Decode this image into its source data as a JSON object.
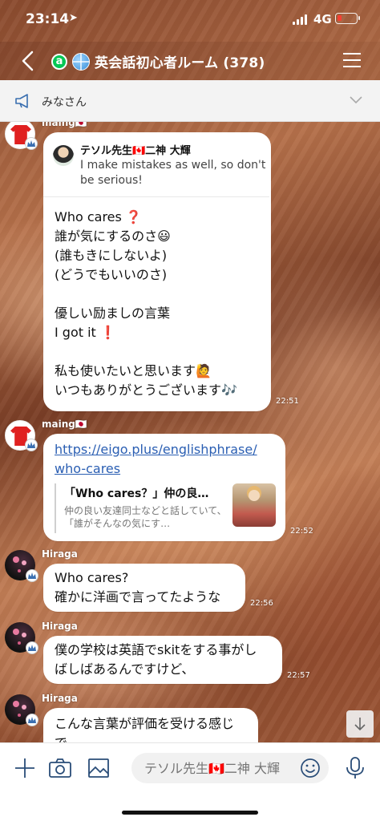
{
  "status_bar": {
    "time": "23:14",
    "network": "4G"
  },
  "header": {
    "room_title": "英会話初心者ルーム (378)"
  },
  "announcement": {
    "text": "みなさん"
  },
  "messages": [
    {
      "sender": "maing🇯🇵",
      "reply_to": {
        "name": "テソル先生🇨🇦二神 大輝",
        "text": "I make mistakes as well, so don't be serious!"
      },
      "lines": [
        "Who cares ❓",
        "誰が気にするのさ😃",
        "(誰もきにしないよ)",
        "(どうでもいいのさ)",
        "",
        "優しい励ましの言葉",
        "I got it ❗",
        "",
        "私も使いたいと思います🙋",
        "いつもありがとうございます🎶"
      ],
      "time": "22:51"
    },
    {
      "sender": "maing🇯🇵",
      "link_line1": "https://eigo.plus/englishphrase/",
      "link_line2": "who-cares",
      "preview_title": "「Who cares？」仲の良…",
      "preview_desc": "仲の良い友達同士などと話していて、「誰がそんなの気にす…",
      "time": "22:52"
    },
    {
      "sender": "Hiraga",
      "lines": [
        "Who cares?",
        "確かに洋画で言ってたような"
      ],
      "time": "22:56"
    },
    {
      "sender": "Hiraga",
      "lines": [
        "僕の学校は英語でskitをする事がし",
        "ばしばあるんですけど、"
      ],
      "time": "22:57"
    },
    {
      "sender": "Hiraga",
      "lines": [
        "こんな言葉が評価を受ける感じ",
        "で"
      ]
    }
  ],
  "input": {
    "placeholder": "テソル先生🇨🇦二神 大輝"
  },
  "icons": {
    "back": "chevron-left-icon",
    "menu": "hamburger-icon",
    "megaphone": "megaphone-icon",
    "plus": "plus-icon",
    "camera": "camera-icon",
    "image": "image-icon",
    "emoji": "smiley-icon",
    "mic": "microphone-icon",
    "scroll": "arrow-down-icon"
  },
  "colors": {
    "line_green": "#06c755",
    "link_blue": "#2b5fb3",
    "battery_low": "#ff3b30"
  }
}
